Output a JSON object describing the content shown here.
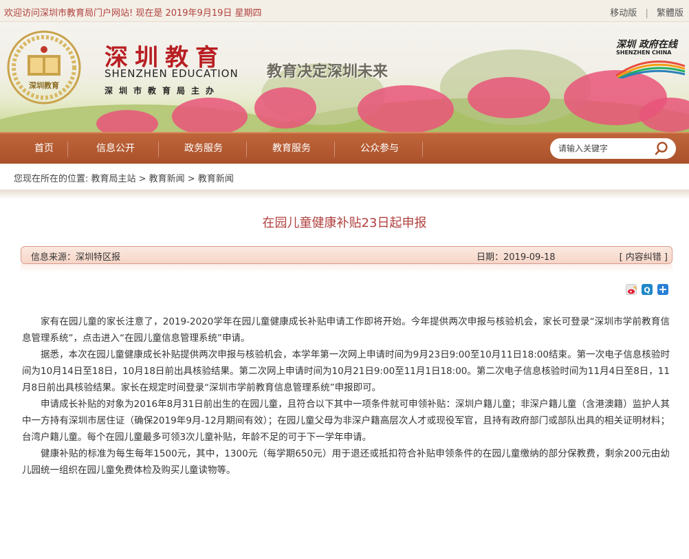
{
  "topbar": {
    "welcome": "欢迎访问深圳市教育局门户网站! 现在是 2019年9月19日 星期四",
    "mobile": "移动版",
    "separator": "|",
    "traditional": "繁體版"
  },
  "header": {
    "logo_text": "深圳教育",
    "brand_cn": "深圳教育",
    "brand_en": "SHENZHEN EDUCATION",
    "brand_sub": "深圳市教育局主办",
    "slogan": "教育决定深圳未来",
    "sz_logo_title": "深圳 政府在线",
    "sz_logo_en": "SHENZHEN CHINA"
  },
  "nav": {
    "items": [
      "首页",
      "信息公开",
      "政务服务",
      "教育服务",
      "公众参与"
    ],
    "search_placeholder": "请输入关键字"
  },
  "breadcrumb": {
    "text": "您现在所在的位置: 教育局主站 > 教育新闻 > 教育新闻"
  },
  "article": {
    "title": "在园儿童健康补贴23日起申报",
    "source": "信息来源：深圳特区报",
    "date": "日期：2019-09-18",
    "correction": "[ 内容纠错 ]",
    "paragraphs": [
      "家有在园儿童的家长注意了，2019-2020学年在园儿童健康成长补贴申请工作即将开始。今年提供两次申报与核验机会，家长可登录“深圳市学前教育信息管理系统”，点击进入“在园儿童信息管理系统”申请。",
      "据悉，本次在园儿童健康成长补贴提供两次申报与核验机会，本学年第一次网上申请时间为9月23日9:00至10月11日18:00结束。第一次电子信息核验时间为10月14日至18日，10月18日前出具核验结果。第二次网上申请时间为10月21日9:00至11月1日18:00。第二次电子信息核验时间为11月4日至8日，11月8日前出具核验结果。家长在规定时间登录“深圳市学前教育信息管理系统”申报即可。",
      "申请成长补贴的对象为2016年8月31日前出生的在园儿童，且符合以下其中一项条件就可申领补贴：深圳户籍儿童；非深户籍儿童（含港澳籍）监护人其中一方持有深圳市居住证（确保2019年9月-12月期间有效）；在园儿童父母为非深户籍高层次人才或现役军官，且持有政府部门或部队出具的相关证明材料；台湾户籍儿童。每个在园儿童最多可领3次儿童补贴，年龄不足的可于下一学年申请。",
      "健康补贴的标准为每生每年1500元，其中，1300元（每学期650元）用于退还或抵扣符合补贴申领条件的在园儿童缴纳的部分保教费，剩余200元由幼儿园统一组织在园儿童免费体检及购买儿童读物等。"
    ]
  },
  "share": {
    "icons": [
      "weibo-icon",
      "qzone-icon",
      "more-share-icon"
    ]
  },
  "colors": {
    "brand_red": "#b81e22",
    "nav_bg": "#a9512b",
    "title": "#b0413e"
  }
}
